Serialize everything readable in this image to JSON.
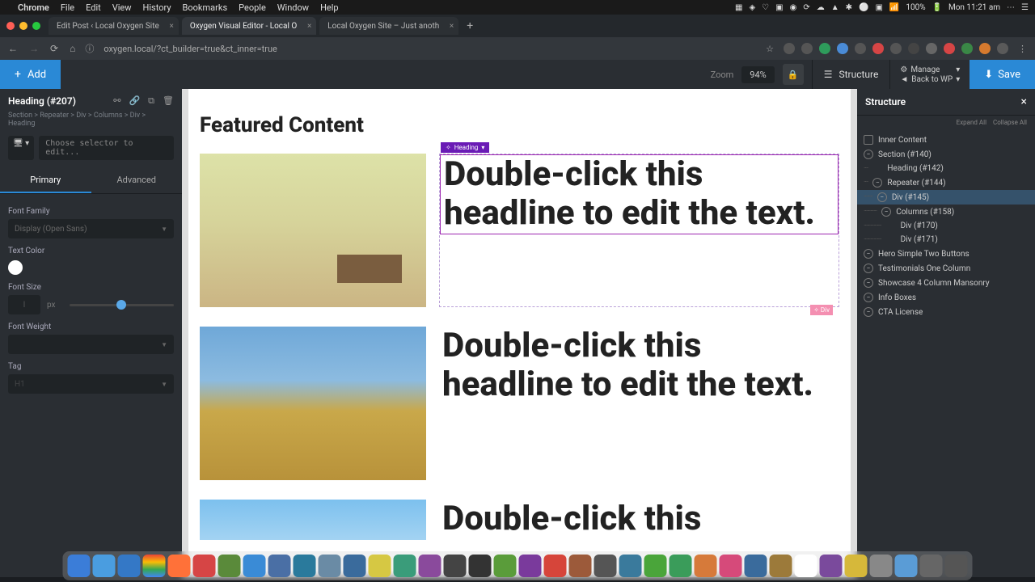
{
  "mac": {
    "app": "Chrome",
    "menus": [
      "File",
      "Edit",
      "View",
      "History",
      "Bookmarks",
      "People",
      "Window",
      "Help"
    ],
    "battery": "100%",
    "clock": "Mon 11:21 am"
  },
  "chrome": {
    "tabs": [
      {
        "label": "Edit Post ‹ Local Oxygen Site"
      },
      {
        "label": "Oxygen Visual Editor - Local O"
      },
      {
        "label": "Local Oxygen Site – Just anoth"
      }
    ],
    "active_tab": 1,
    "url": "oxygen.local/?ct_builder=true&ct_inner=true"
  },
  "header": {
    "add": "Add",
    "zoom_label": "Zoom",
    "zoom_value": "94%",
    "structure": "Structure",
    "manage": "Manage",
    "back": "Back to WP",
    "save": "Save"
  },
  "left": {
    "title": "Heading (#207)",
    "breadcrumb": "Section > Repeater > Div > Columns > Div > Heading",
    "selector_placeholder": "Choose selector to edit...",
    "tabs": {
      "primary": "Primary",
      "advanced": "Advanced"
    },
    "font_family_label": "Font Family",
    "font_family_value": "Display (Open Sans)",
    "text_color_label": "Text Color",
    "font_size_label": "Font Size",
    "font_size_unit": "px",
    "font_weight_label": "Font Weight",
    "tag_label": "Tag",
    "tag_value": "H1"
  },
  "canvas": {
    "section_title": "Featured Content",
    "heading_text": "Double-click this headline to edit the text.",
    "sel_badge": "Heading",
    "pink_badge": "Div"
  },
  "structure": {
    "title": "Structure",
    "expand": "Expand All",
    "collapse": "Collapse All",
    "tree": [
      {
        "label": "Inner Content",
        "indent": 0,
        "icon": "sq"
      },
      {
        "label": "Section (#140)",
        "indent": 0,
        "icon": "rd"
      },
      {
        "label": "Heading (#142)",
        "indent": 1,
        "icon": "none"
      },
      {
        "label": "Repeater (#144)",
        "indent": 1,
        "icon": "rd"
      },
      {
        "label": "Div (#145)",
        "indent": 2,
        "icon": "rd",
        "hl": true
      },
      {
        "label": "Columns (#158)",
        "indent": 3,
        "icon": "rd"
      },
      {
        "label": "Div (#170)",
        "indent": 4,
        "icon": "none"
      },
      {
        "label": "Div (#171)",
        "indent": 4,
        "icon": "none"
      },
      {
        "label": "Hero Simple Two Buttons",
        "indent": 0,
        "icon": "rd"
      },
      {
        "label": "Testimonials One Column",
        "indent": 0,
        "icon": "rd"
      },
      {
        "label": "Showcase 4 Column Mansonry",
        "indent": 0,
        "icon": "rd"
      },
      {
        "label": "Info Boxes",
        "indent": 0,
        "icon": "rd"
      },
      {
        "label": "CTA License",
        "indent": 0,
        "icon": "rd"
      }
    ]
  }
}
